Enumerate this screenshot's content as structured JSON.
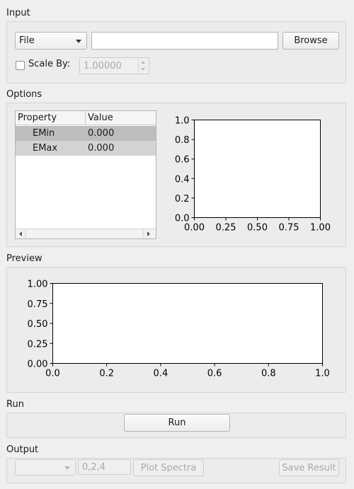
{
  "input": {
    "section_label": "Input",
    "source_type": "File",
    "file_path_value": "",
    "browse_label": "Browse",
    "scale_checked": false,
    "scale_label": "Scale By:",
    "scale_value": "1.00000"
  },
  "options": {
    "section_label": "Options",
    "table": {
      "columns": [
        "Property",
        "Value"
      ],
      "rows": [
        {
          "property": "EMin",
          "value": "0.000"
        },
        {
          "property": "EMax",
          "value": "0.000"
        }
      ]
    },
    "plot": {
      "x_ticks": [
        "0.00",
        "0.25",
        "0.50",
        "0.75",
        "1.00"
      ],
      "y_ticks": [
        "0.0",
        "0.2",
        "0.4",
        "0.6",
        "0.8",
        "1.0"
      ]
    }
  },
  "preview": {
    "section_label": "Preview",
    "plot": {
      "x_ticks": [
        "0.0",
        "0.2",
        "0.4",
        "0.6",
        "0.8",
        "1.0"
      ],
      "y_ticks": [
        "0.00",
        "0.25",
        "0.50",
        "0.75",
        "1.00"
      ]
    }
  },
  "run": {
    "section_label": "Run",
    "run_label": "Run"
  },
  "output": {
    "section_label": "Output",
    "workspace_value": "",
    "indices_placeholder": "0,2,4",
    "plot_spectra_label": "Plot Spectra",
    "save_result_label": "Save Result"
  }
}
